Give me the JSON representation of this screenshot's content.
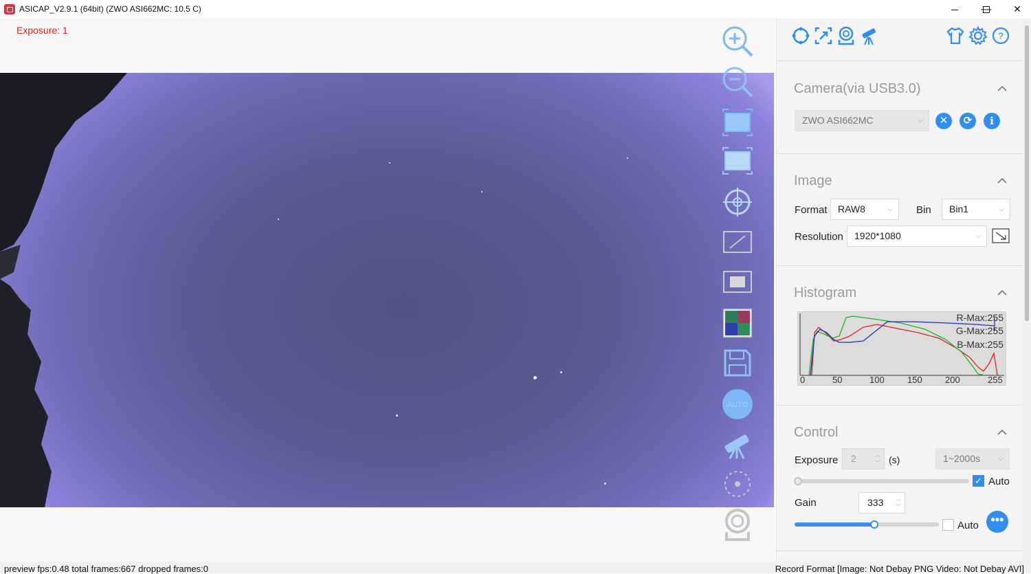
{
  "window": {
    "title": "ASICAP_V2.9.1 (64bit) (ZWO ASI662MC: 10.5 C)",
    "minimize": "—",
    "maximize": "☐",
    "close": "✕"
  },
  "preview": {
    "exposure_label": "Exposure: 1"
  },
  "tools": [
    {
      "name": "zoom-in-icon"
    },
    {
      "name": "zoom-out-icon"
    },
    {
      "name": "fit-screen-icon"
    },
    {
      "name": "full-screen-icon"
    },
    {
      "name": "crosshair-icon"
    },
    {
      "name": "roi-icon"
    },
    {
      "name": "overlay-icon"
    },
    {
      "name": "color-balance-icon"
    },
    {
      "name": "save-icon"
    },
    {
      "name": "auto-button"
    },
    {
      "name": "telescope-icon"
    },
    {
      "name": "focus-icon"
    },
    {
      "name": "camera-icon"
    }
  ],
  "panel": {
    "top_icons": [
      "target-icon",
      "capture-icon",
      "camera-icon",
      "telescope-icon",
      "skin-icon",
      "settings-icon",
      "help-icon"
    ],
    "camera": {
      "title": "Camera(via USB3.0)",
      "selected": "ZWO ASI662MC"
    },
    "image": {
      "title": "Image",
      "format_label": "Format",
      "format_value": "RAW8",
      "bin_label": "Bin",
      "bin_value": "Bin1",
      "resolution_label": "Resolution",
      "resolution_value": "1920*1080"
    },
    "histogram": {
      "title": "Histogram",
      "r_max": "R-Max:255",
      "g_max": "G-Max:255",
      "b_max": "B-Max:255",
      "ticks": [
        "0",
        "50",
        "100",
        "150",
        "200",
        "255"
      ]
    },
    "control": {
      "title": "Control",
      "exposure_label": "Exposure",
      "exposure_value": "2",
      "exposure_unit": "(s)",
      "exposure_range": "1~2000s",
      "exposure_auto_label": "Auto",
      "exposure_auto": true,
      "gain_label": "Gain",
      "gain_value": "333",
      "gain_auto_label": "Auto",
      "gain_auto": false,
      "gain_slider_fraction": 0.55
    }
  },
  "status": {
    "left": "preview fps:0.48  total frames:667  dropped frames:0",
    "right": "Record Format [Image: Not Debay PNG Video: Not Debay AVI]"
  },
  "colors": {
    "accent": "#2f8ef0",
    "exposure_label": "#e0231d",
    "tool_icon": "#7db7f5"
  }
}
